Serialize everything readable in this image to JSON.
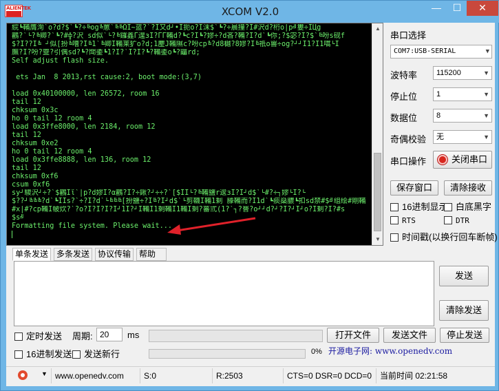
{
  "window": {
    "logo_top": "ALIENTEK",
    "title": "XCOM V2.0",
    "minimize_glyph": "—",
    "maximize_glyph": "☐",
    "close_glyph": "✕"
  },
  "terminal": {
    "lines": [
      "綄┗鞴膺洵`o?d?$`┗?÷╚og╚罳`╚╚ΩI~蓝?`?Ι又d┘•Ι扼ο?Ι沫$`┗?÷晨撞?Ι#沢d?桁o|p╝婁÷ΙЦg",
      "鸛?`└?╚卿?`┗?#╬?沢 sd似`└?╚鑼鑫Γ遑зΙ?ГГ鞴d?┗c?Ι┗?嫪÷?d吝?鞴?Ι?d`┗你;?$宓?Ι?$`╚吩s砚f",
      "$?Ι??Ι╚ ┘似[扮╚嘈?Ι╚1`╚卿I鞴莱犷ο?d;1麈J鞴隰c?吩cp╚?d8樾?8嫪?Ι╚祇o嘼÷og?┘┘Ι1?Ι1嚆└Ι",
      "廡?Ι?吩?韲?引偶sd?┗?閗鋈┗1?Ι?`Ι?Ι?┗?鞴鋈o┗?鼺rd;",
      "Self adjust flash size.",
      "",
      " ets Jan  8 2013,rst cause:2, boot mode:(3,7)",
      "",
      "load 0x40100000, len 26572, room 16",
      "tail 12",
      "chksum 0x3c",
      "ho 0 tail 12 room 4",
      "load 0x3ffe8000, len 2184, room 12",
      "tail 12",
      "chksum 0xe2",
      "ho 0 tail 12 room 4",
      "load 0x3ffe8888, len 136, room 12",
      "tail 12",
      "chksum 0xf6",
      "csum 0xf6",
      "sy┘騣沢┘÷?`$鸛Ιϊ`|p?d嫪Ι?α鸛?Ι?÷鍬?┘÷÷?`[$ΙΙ└?╚鞴鹽r逡зΙ?Ι┘d$`└#?÷┐嫪└Ι?└",
      "$??┘╚╚╚?d`┗ΙΙs?`÷?Ι?d`└╚╚╚[扮鹽÷?Ι╚?Ι┘d$`└剪韈Ι鞴1剩 滕鞴而?Ι1d`┗痰燊膿┗扣sd禁#$╝组绘#剛鞴",
      "#x|#?cp鞴Ι帔炊?`?o?Ι?Ι?Ι?Ι┘1Ι?┘Ι鞴Ι1剩鞴Ι1鞴Ι剩?蕃弎(1?`┐?罾?o┘┘d?┘?Ι?┘Ι┘ο?Ι剩?Ι?#s",
      "$s╝",
      "Formatting file system. Please wait..."
    ]
  },
  "right_panel": {
    "port_select_label": "串口选择",
    "port_value": "COM7:USB-SERIAL",
    "baud_label": "波特率",
    "baud_value": "115200",
    "stopbits_label": "停止位",
    "stopbits_value": "1",
    "databits_label": "数据位",
    "databits_value": "8",
    "parity_label": "奇偶校验",
    "parity_value": "无",
    "port_op_label": "串口操作",
    "close_port_button": "关闭串口",
    "save_window_button": "保存窗口",
    "clear_receive_button": "清除接收",
    "hex_display_label": "16进制显示",
    "white_bg_label": "白底黑字",
    "rts_label": "RTS",
    "dtr_label": "DTR",
    "timestamp_label": "时间戳(以换行回车断帧)"
  },
  "tabs": [
    {
      "label": "单条发送",
      "active": true
    },
    {
      "label": "多条发送",
      "active": false
    },
    {
      "label": "协议传输",
      "active": false
    },
    {
      "label": "帮助",
      "active": false
    }
  ],
  "send": {
    "text": "",
    "send_button": "发送",
    "clear_send_button": "清除发送",
    "timed_send_label": "定时发送",
    "period_label": "周期:",
    "period_value": "20",
    "ms_label": "ms",
    "open_file_button": "打开文件",
    "send_file_button": "发送文件",
    "stop_send_button": "停止发送",
    "hex_send_label": "16进制发送",
    "send_newline_label": "发送新行",
    "progress_text": "0%",
    "progress": 0,
    "website_text": "开源电子网: www.openedv.com"
  },
  "statusbar": {
    "url": "www.openedv.com",
    "sent": "S:0",
    "received": "R:2503",
    "signals": "CTS=0 DSR=0 DCD=0",
    "time": "当前时间 02:21:58"
  },
  "colors": {
    "terminal_bg": "#000000",
    "terminal_fg": "#6cf06c",
    "titlebar": "#6fb6e6",
    "close_button": "#c9483c",
    "arrow": "#e0212a"
  }
}
